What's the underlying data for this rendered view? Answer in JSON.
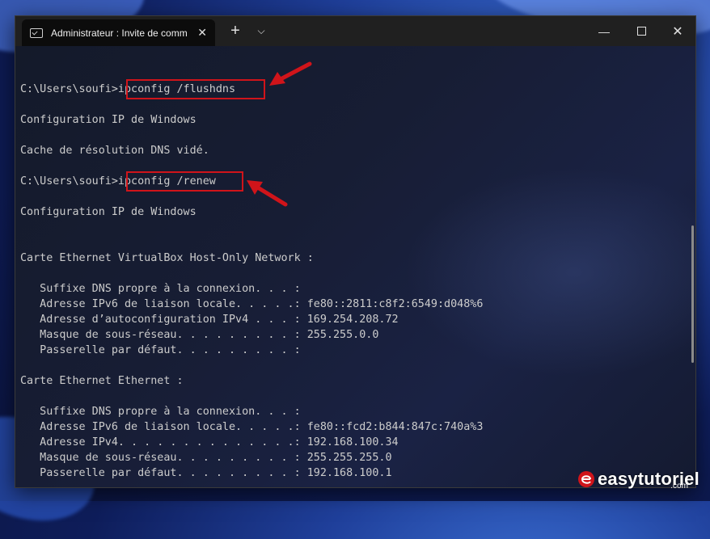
{
  "window": {
    "tab_title": "Administrateur : Invite de commandes",
    "tab_close": "✕",
    "add_tab": "+",
    "dropdown": "⌵",
    "minimize": "—",
    "close": "✕"
  },
  "console": {
    "lines": [
      "C:\\Users\\soufi>ipconfig /flushdns",
      "Configuration IP de Windows",
      "Cache de résolution DNS vidé.",
      "C:\\Users\\soufi>ipconfig /renew",
      "Configuration IP de Windows",
      "Carte Ethernet VirtualBox Host-Only Network :",
      "   Suffixe DNS propre à la connexion. . . :",
      "   Adresse IPv6 de liaison locale. . . . .: fe80::2811:c8f2:6549:d048%6",
      "   Adresse d’autoconfiguration IPv4 . . . : 169.254.208.72",
      "   Masque de sous-réseau. . . . . . . . . : 255.255.0.0",
      "   Passerelle par défaut. . . . . . . . . :",
      "Carte Ethernet Ethernet :",
      "   Suffixe DNS propre à la connexion. . . :",
      "   Adresse IPv6 de liaison locale. . . . .: fe80::fcd2:b844:847c:740a%3",
      "   Adresse IPv4. . . . . . . . . . . . . .: 192.168.100.34",
      "   Masque de sous-réseau. . . . . . . . . : 255.255.255.0",
      "   Passerelle par défaut. . . . . . . . . : 192.168.100.1"
    ]
  },
  "watermark": {
    "brand": "easytutoriel",
    "suffix": ".com"
  },
  "colors": {
    "highlight": "#d0141a",
    "console_text": "#cccccc",
    "titlebar": "#202020"
  },
  "icons": {
    "tab": "cmd-icon",
    "arrow": "red-arrow-icon",
    "logo": "easytutoriel-logo-icon"
  }
}
